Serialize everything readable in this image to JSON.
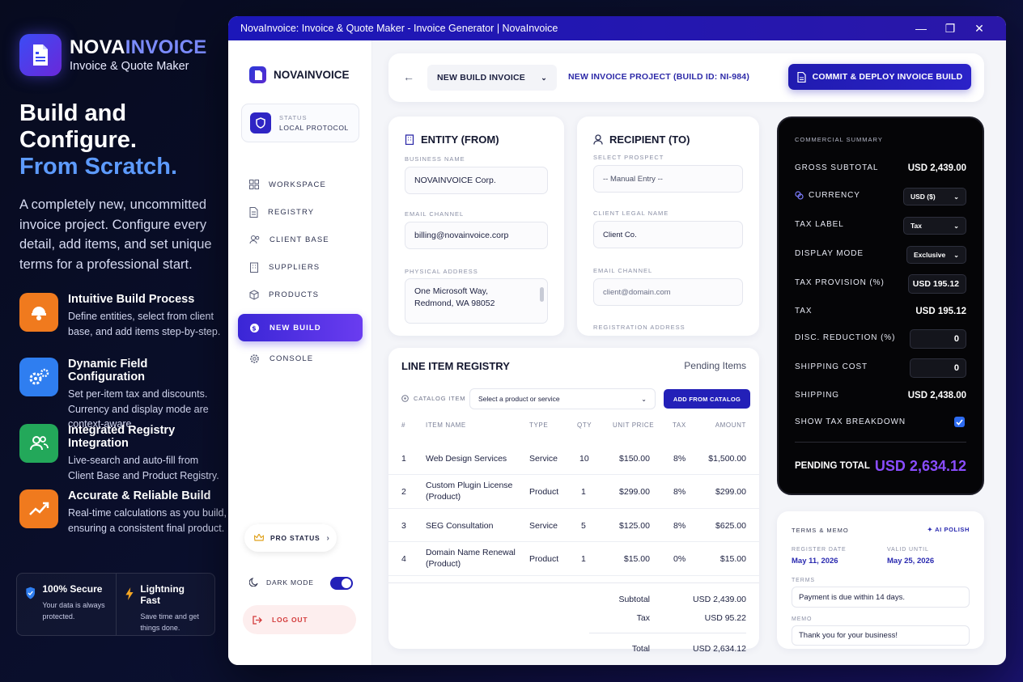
{
  "promo": {
    "brand_a": "NOVA",
    "brand_b": "INVOICE",
    "brand_sub": "Invoice & Quote Maker",
    "hero_1": "Build and",
    "hero_2": "Configure.",
    "hero_3": "From Scratch.",
    "lead": "A completely new, uncommitted invoice project. Configure every detail, add items, and set unique terms for a professional start.",
    "features": [
      {
        "title": "Intuitive Build Process",
        "desc": "Define entities, select from client base, and add items step-by-step.",
        "color": "#f07a1e"
      },
      {
        "title": "Dynamic Field Configuration",
        "desc": "Set per-item tax and discounts. Currency and display mode are context-aware.",
        "color": "#2f7ef0"
      },
      {
        "title": "Integrated Registry Integration",
        "desc": "Live-search and auto-fill from Client Base and Product Registry.",
        "color": "#23a85a"
      },
      {
        "title": "Accurate & Reliable Build",
        "desc": "Real-time calculations as you build, ensuring a consistent final product.",
        "color": "#f07a1e"
      }
    ],
    "badges": [
      {
        "title": "100% Secure",
        "desc": "Your data is always protected."
      },
      {
        "title": "Lightning Fast",
        "desc": "Save time and get things done."
      }
    ]
  },
  "window": {
    "title": "NovaInvoice: Invoice & Quote Maker - Invoice Generator | NovaInvoice"
  },
  "sidebar": {
    "brand": "NOVAINVOICE",
    "status_label": "STATUS",
    "status_value": "LOCAL PROTOCOL",
    "items": [
      {
        "label": "WORKSPACE",
        "icon": "grid-icon"
      },
      {
        "label": "REGISTRY",
        "icon": "document-icon"
      },
      {
        "label": "CLIENT BASE",
        "icon": "users-icon"
      },
      {
        "label": "SUPPLIERS",
        "icon": "building-icon"
      },
      {
        "label": "PRODUCTS",
        "icon": "box-icon"
      },
      {
        "label": "NEW BUILD",
        "icon": "dollar-icon"
      },
      {
        "label": "CONSOLE",
        "icon": "gear-icon"
      }
    ],
    "pro": "PRO STATUS",
    "dark_mode": "DARK MODE",
    "logout": "LOG OUT"
  },
  "topbar": {
    "build_select": "NEW BUILD INVOICE",
    "project": "NEW INVOICE PROJECT (BUILD ID: NI-984)",
    "commit": "COMMIT & DEPLOY INVOICE BUILD"
  },
  "entity": {
    "title": "ENTITY (FROM)",
    "business_label": "BUSINESS NAME",
    "business": "NOVAINVOICE Corp.",
    "email_label": "EMAIL CHANNEL",
    "email": "billing@novainvoice.corp",
    "address_label": "PHYSICAL ADDRESS",
    "address_1": "One Microsoft Way,",
    "address_2": "Redmond, WA 98052"
  },
  "recipient": {
    "title": "RECIPIENT (TO)",
    "prospect_label": "SELECT PROSPECT",
    "prospect": "-- Manual Entry --",
    "legal_label": "CLIENT LEGAL NAME",
    "legal": "Client Co.",
    "email_label": "EMAIL CHANNEL",
    "email_placeholder": "client@domain.com",
    "address_label": "REGISTRATION ADDRESS"
  },
  "line_items": {
    "title": "LINE ITEM REGISTRY",
    "pending": "Pending Items",
    "catalog_label": "CATALOG ITEM",
    "catalog_select": "Select a product or service",
    "add_catalog": "ADD FROM CATALOG",
    "headers": {
      "num": "#",
      "name": "ITEM NAME",
      "type": "TYPE",
      "qty": "QTY",
      "price": "UNIT PRICE",
      "tax": "TAX",
      "amount": "AMOUNT"
    },
    "rows": [
      {
        "num": "1",
        "name": "Web Design Services",
        "type": "Service",
        "qty": "10",
        "price": "$150.00",
        "tax": "8%",
        "amount": "$1,500.00"
      },
      {
        "num": "2",
        "name": "Custom Plugin License (Product)",
        "type": "Product",
        "qty": "1",
        "price": "$299.00",
        "tax": "8%",
        "amount": "$299.00"
      },
      {
        "num": "3",
        "name": "SEG Consultation",
        "type": "Service",
        "qty": "5",
        "price": "$125.00",
        "tax": "8%",
        "amount": "$625.00"
      },
      {
        "num": "4",
        "name": "Domain Name Renewal (Product)",
        "type": "Product",
        "qty": "1",
        "price": "$15.00",
        "tax": "0%",
        "amount": "$15.00"
      }
    ],
    "subtotal_label": "Subtotal",
    "subtotal": "USD 2,439.00",
    "tax_label": "Tax",
    "tax": "USD 95.22",
    "total_label": "Total",
    "total": "USD 2,634.12"
  },
  "summary": {
    "title": "COMMERCIAL SUMMARY",
    "gross_label": "GROSS SUBTOTAL",
    "gross": "USD 2,439.00",
    "currency_label": "CURRENCY",
    "currency": "USD ($)",
    "tax_label_label": "TAX LABEL",
    "tax_label": "Tax",
    "display_label": "DISPLAY MODE",
    "display": "Exclusive",
    "provision_label": "TAX PROVISION (%)",
    "provision": "USD 195.12",
    "tax_row_label": "TAX",
    "tax_row": "USD 195.12",
    "disc_label": "DISC. REDUCTION (%)",
    "disc": "0",
    "ship_cost_label": "SHIPPING COST",
    "ship_cost": "0",
    "shipping_label": "SHIPPING",
    "shipping": "USD 2,438.00",
    "breakdown_label": "SHOW TAX BREAKDOWN",
    "breakdown_checked": true,
    "pending_label": "PENDING TOTAL",
    "pending": "USD 2,634.12"
  },
  "terms": {
    "title": "TERMS & MEMO",
    "ai": "AI POLISH",
    "register_label": "REGISTER DATE",
    "register": "May 11, 2026",
    "valid_label": "VALID UNTIL",
    "valid": "May 25, 2026",
    "terms_label": "TERMS",
    "terms": "Payment is due within 14 days.",
    "memo_label": "MEMO",
    "memo": "Thank you for your business!"
  }
}
